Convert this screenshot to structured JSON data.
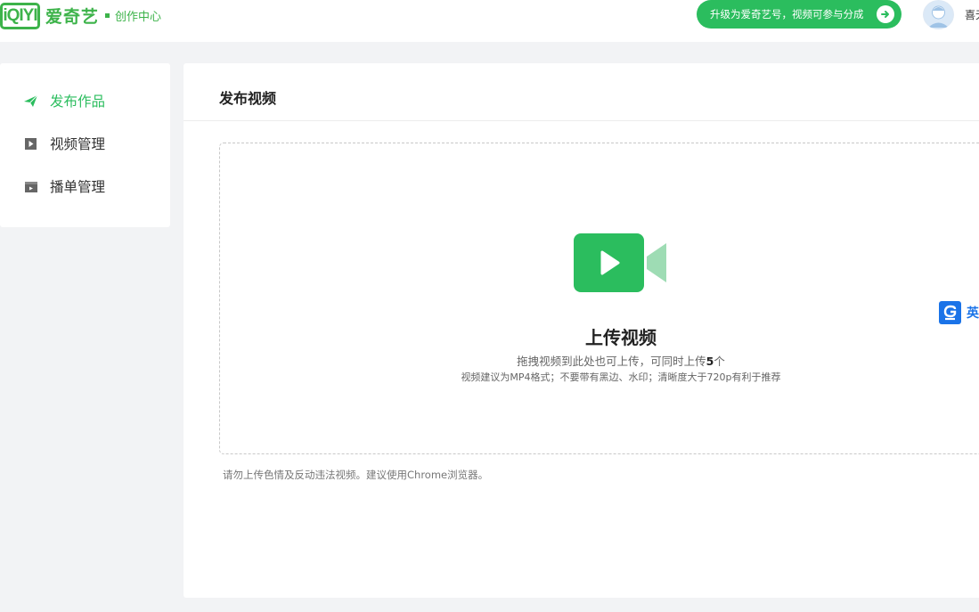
{
  "header": {
    "logo_badge": "iQIYI",
    "logo_cn": "爱奇艺",
    "logo_sub": "创作中心",
    "upgrade_label": "升级为爱奇艺号，视频可参与分成",
    "user_name": "喜无"
  },
  "sidebar": {
    "items": [
      {
        "label": "发布作品",
        "icon": "paper-plane-icon",
        "active": true
      },
      {
        "label": "视频管理",
        "icon": "play-square-icon",
        "active": false
      },
      {
        "label": "播单管理",
        "icon": "folder-icon",
        "active": false
      }
    ]
  },
  "main": {
    "title": "发布视频",
    "upload_title": "上传视频",
    "upload_hint_prefix": "拖拽视频到此处也可上传，可同时上传",
    "upload_hint_count": "5",
    "upload_hint_suffix": "个",
    "upload_recommend": "视频建议为MP4格式；不要带有黑边、水印；清晰度大于720p有利于推荐",
    "notice": "请勿上传色情及反动违法视频。建议使用Chrome浏览器。"
  },
  "floating_badge": {
    "letter": "g",
    "text": "英"
  },
  "colors": {
    "brand": "#3db34a",
    "accent": "#2bbd5e",
    "accent_light": "#9edcb4",
    "badge_blue": "#1a73e8"
  }
}
